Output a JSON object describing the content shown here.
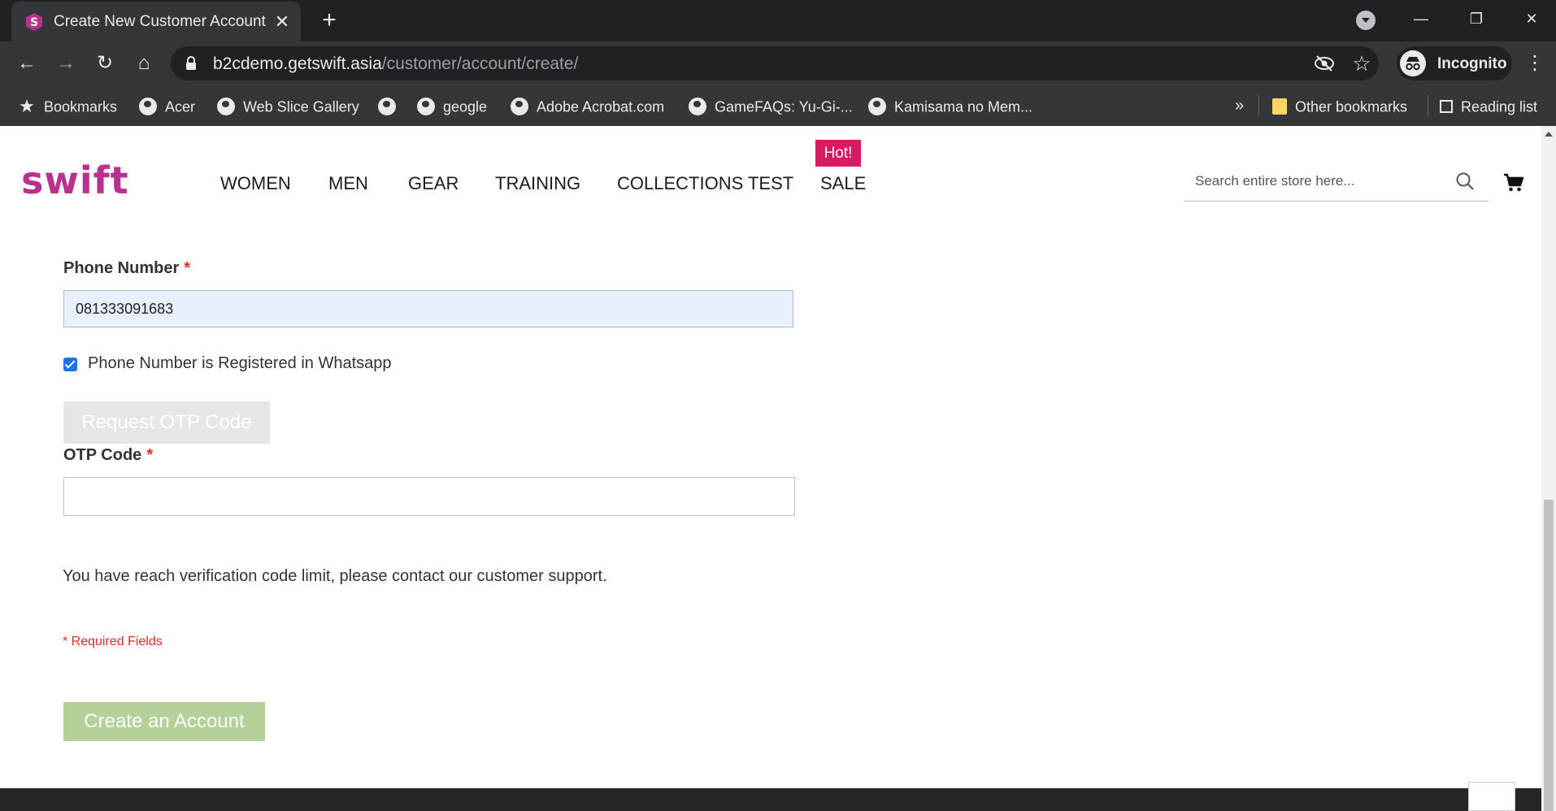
{
  "browser": {
    "tab_title": "Create New Customer Account",
    "url_host": "b2cdemo.getswift.asia",
    "url_path": "/customer/account/create/",
    "profile_label": "Incognito",
    "bookmarks": [
      "Bookmarks",
      "Acer",
      "Web Slice Gallery",
      "",
      "geogle",
      "Adobe Acrobat.com",
      "GameFAQs: Yu-Gi-...",
      "Kamisama no Mem..."
    ],
    "overflow_label": "»",
    "other_bookmarks": "Other bookmarks",
    "reading_list": "Reading list"
  },
  "site": {
    "logo": "swift",
    "nav": [
      "WOMEN",
      "MEN",
      "GEAR",
      "TRAINING",
      "COLLECTIONS TEST",
      "SALE"
    ],
    "hot_badge": "Hot!",
    "search_placeholder": "Search entire store here...",
    "brand_color": "#b9308f",
    "hot_color": "#d81b60"
  },
  "form": {
    "phone_label": "Phone Number",
    "phone_value": "081333091683",
    "required_mark": "*",
    "whatsapp_label": "Phone Number is Registered in Whatsapp",
    "whatsapp_checked": true,
    "otp_button": "Request OTP Code",
    "otp_label": "OTP Code",
    "otp_value": "",
    "limit_message": "You have reach verification code limit, please contact our customer support.",
    "required_fields": "* Required Fields",
    "create_button": "Create an Account"
  }
}
